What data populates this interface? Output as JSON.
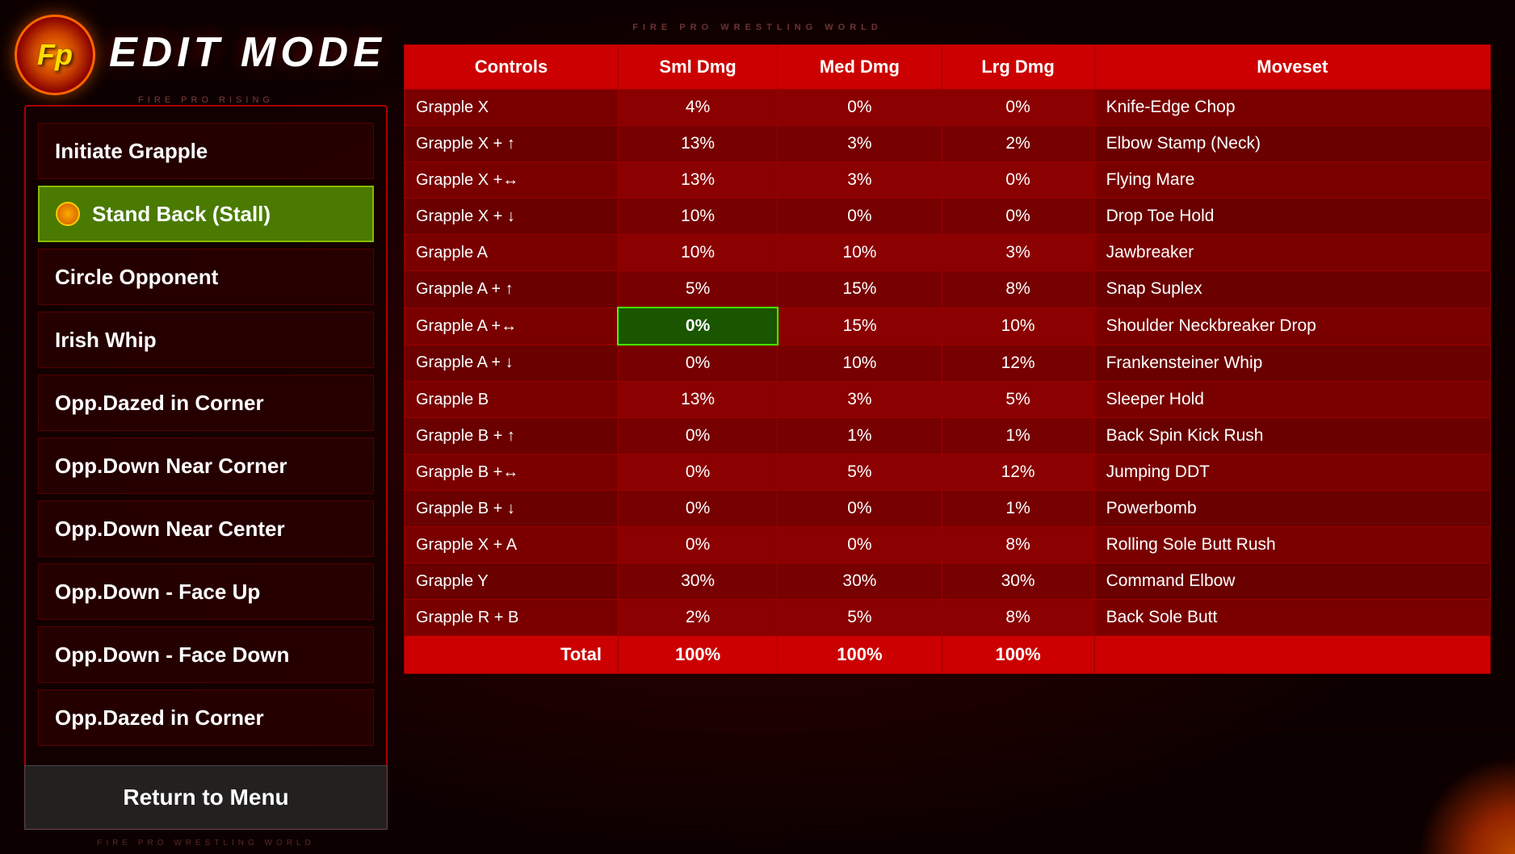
{
  "logo": {
    "text": "Fp"
  },
  "title": "EDIT MODE",
  "watermark_top": "FIRE PRO WRESTLING WORLD",
  "watermark_bottom": "FIRE PRO WRESTLING WORLD",
  "left_panel_title": "FIRE PRO RISING",
  "menu": {
    "items": [
      {
        "label": "Initiate Grapple",
        "active": false,
        "has_icon": false
      },
      {
        "label": "Stand Back (Stall)",
        "active": true,
        "has_icon": true
      },
      {
        "label": "Circle Opponent",
        "active": false,
        "has_icon": false
      },
      {
        "label": "Irish Whip",
        "active": false,
        "has_icon": false
      },
      {
        "label": "Opp.Dazed in Corner",
        "active": false,
        "has_icon": false
      },
      {
        "label": "Opp.Down Near Corner",
        "active": false,
        "has_icon": false
      },
      {
        "label": "Opp.Down Near Center",
        "active": false,
        "has_icon": false
      },
      {
        "label": "Opp.Down - Face Up",
        "active": false,
        "has_icon": false
      },
      {
        "label": "Opp.Down - Face Down",
        "active": false,
        "has_icon": false
      },
      {
        "label": "Opp.Dazed in Corner",
        "active": false,
        "has_icon": false
      }
    ],
    "return_label": "Return to Menu"
  },
  "table": {
    "headers": {
      "controls": "Controls",
      "sml_dmg": "Sml Dmg",
      "med_dmg": "Med Dmg",
      "lrg_dmg": "Lrg Dmg",
      "moveset": "Moveset"
    },
    "rows": [
      {
        "controls": "Grapple X",
        "sml": "4%",
        "med": "0%",
        "lrg": "0%",
        "moveset": "Knife-Edge Chop",
        "highlighted": ""
      },
      {
        "controls": "Grapple X + ↑",
        "sml": "13%",
        "med": "3%",
        "lrg": "2%",
        "moveset": "Elbow Stamp (Neck)",
        "highlighted": ""
      },
      {
        "controls": "Grapple X +↔",
        "sml": "13%",
        "med": "3%",
        "lrg": "0%",
        "moveset": "Flying Mare",
        "highlighted": ""
      },
      {
        "controls": "Grapple X + ↓",
        "sml": "10%",
        "med": "0%",
        "lrg": "0%",
        "moveset": "Drop Toe Hold",
        "highlighted": ""
      },
      {
        "controls": "Grapple A",
        "sml": "10%",
        "med": "10%",
        "lrg": "3%",
        "moveset": "Jawbreaker",
        "highlighted": ""
      },
      {
        "controls": "Grapple A + ↑",
        "sml": "5%",
        "med": "15%",
        "lrg": "8%",
        "moveset": "Snap Suplex",
        "highlighted": ""
      },
      {
        "controls": "Grapple A +↔",
        "sml": "0%",
        "med": "15%",
        "lrg": "10%",
        "moveset": "Shoulder Neckbreaker Drop",
        "highlighted": "sml"
      },
      {
        "controls": "Grapple A + ↓",
        "sml": "0%",
        "med": "10%",
        "lrg": "12%",
        "moveset": "Frankensteiner Whip",
        "highlighted": ""
      },
      {
        "controls": "Grapple B",
        "sml": "13%",
        "med": "3%",
        "lrg": "5%",
        "moveset": "Sleeper Hold",
        "highlighted": ""
      },
      {
        "controls": "Grapple B + ↑",
        "sml": "0%",
        "med": "1%",
        "lrg": "1%",
        "moveset": "Back Spin Kick Rush",
        "highlighted": ""
      },
      {
        "controls": "Grapple B +↔",
        "sml": "0%",
        "med": "5%",
        "lrg": "12%",
        "moveset": "Jumping DDT",
        "highlighted": ""
      },
      {
        "controls": "Grapple B + ↓",
        "sml": "0%",
        "med": "0%",
        "lrg": "1%",
        "moveset": "Powerbomb",
        "highlighted": ""
      },
      {
        "controls": "Grapple X + A",
        "sml": "0%",
        "med": "0%",
        "lrg": "8%",
        "moveset": "Rolling Sole Butt Rush",
        "highlighted": ""
      },
      {
        "controls": "Grapple Y",
        "sml": "30%",
        "med": "30%",
        "lrg": "30%",
        "moveset": "Command Elbow",
        "highlighted": ""
      },
      {
        "controls": "Grapple R + B",
        "sml": "2%",
        "med": "5%",
        "lrg": "8%",
        "moveset": "Back Sole Butt",
        "highlighted": ""
      }
    ],
    "total": {
      "label": "Total",
      "sml": "100%",
      "med": "100%",
      "lrg": "100%"
    }
  }
}
